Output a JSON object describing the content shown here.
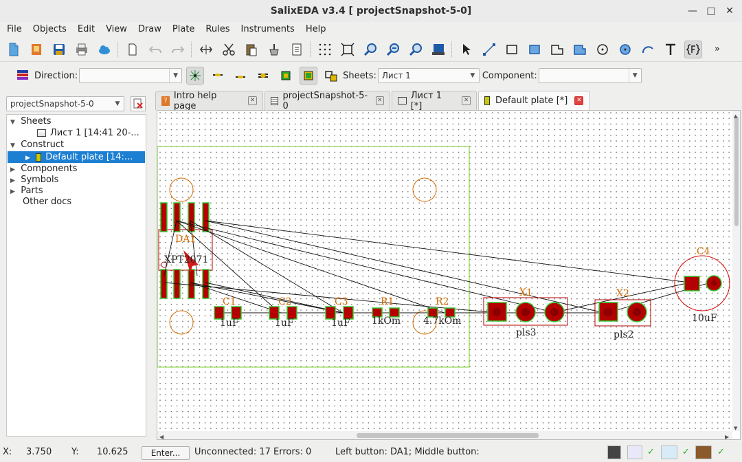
{
  "window": {
    "title": "SalixEDA v3.4 [ projectSnapshot-5-0]"
  },
  "menu": [
    "File",
    "Objects",
    "Edit",
    "View",
    "Draw",
    "Plate",
    "Rules",
    "Instruments",
    "Help"
  ],
  "toolbar2": {
    "direction_label": "Direction:",
    "direction_value": "",
    "sheets_label": "Sheets:",
    "sheets_value": "Лист 1",
    "component_label": "Component:",
    "component_value": ""
  },
  "sidebar": {
    "project_select": "projectSnapshot-5-0",
    "tree": [
      {
        "label": "Sheets",
        "expander": "open"
      },
      {
        "label": "Лист 1 [14:41 20-..."
      },
      {
        "label": "Construct",
        "expander": "open"
      },
      {
        "label": "Default plate [14:...",
        "expander": "closed",
        "selected": true
      },
      {
        "label": "Components",
        "expander": "closed"
      },
      {
        "label": "Symbols",
        "expander": "closed"
      },
      {
        "label": "Parts",
        "expander": "closed"
      },
      {
        "label": "Other docs"
      }
    ]
  },
  "tabs": [
    {
      "label": "Intro help page"
    },
    {
      "label": "projectSnapshot-5-0"
    },
    {
      "label": "Лист 1 [*]"
    },
    {
      "label": "Default plate [*]",
      "active": true
    }
  ],
  "pcb": {
    "labels": {
      "da1": "DA1",
      "da1_part": "XPT2071",
      "c1": "C1",
      "c1_v": "1uF",
      "c2": "C2",
      "c2_v": "1uF",
      "c3": "C3",
      "c3_v": "1uF",
      "r1": "R1",
      "r1_v": "1kOm",
      "r2": "R2",
      "r2_v": "4.7kOm",
      "x1": "X1",
      "x1_v": "pls3",
      "x2": "X2",
      "x2_v": "pls2",
      "c4": "C4",
      "c4_v": "10uF"
    },
    "colors": {
      "pad": "#b40000",
      "pad_border": "#33cc33",
      "silk": "#d46a00",
      "outline": "#b40000",
      "board": "#8bd64a"
    }
  },
  "status": {
    "x_label": "X:",
    "x_value": "3.750",
    "y_label": "Y:",
    "y_value": "10.625",
    "enter_label": "Enter...",
    "unconnected": "Unconnected: 17  Errors: 0",
    "buttons": "Left button: DA1;   Middle button:"
  }
}
